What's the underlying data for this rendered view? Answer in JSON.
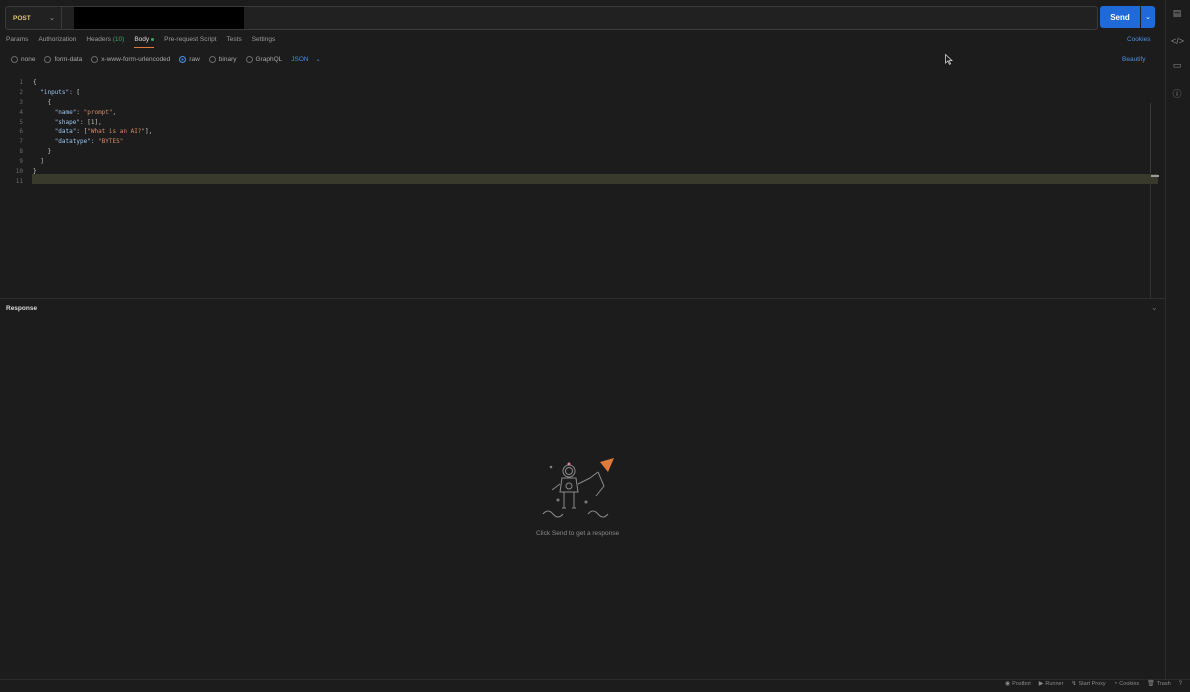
{
  "request": {
    "method": "POST",
    "send_label": "Send"
  },
  "tabs": [
    {
      "label": "Params"
    },
    {
      "label": "Authorization"
    },
    {
      "label": "Headers",
      "count": "(10)"
    },
    {
      "label": "Body"
    },
    {
      "label": "Pre-request Script"
    },
    {
      "label": "Tests"
    },
    {
      "label": "Settings"
    }
  ],
  "cookies_link": "Cookies",
  "body_types": [
    "none",
    "form-data",
    "x-www-form-urlencoded",
    "raw",
    "binary",
    "GraphQL"
  ],
  "body_type_selected": "raw",
  "format": "JSON",
  "beautify_label": "Beautify",
  "editor": {
    "line_numbers": [
      "1",
      "2",
      "3",
      "4",
      "5",
      "6",
      "7",
      "8",
      "9",
      "10",
      "11"
    ],
    "lines": [
      "{",
      "  \"inputs\": [",
      "    {",
      "      \"name\": \"prompt\",",
      "      \"shape\": [1],",
      "      \"data\": [\"What is an AI?\"],",
      "      \"datatype\": \"BYTES\"",
      "    }",
      "  ]",
      "}",
      ""
    ]
  },
  "response": {
    "title": "Response",
    "empty_message": "Click Send to get a response"
  },
  "statusbar": [
    {
      "label": "Postbot",
      "icon": "postbot-icon"
    },
    {
      "label": "Runner",
      "icon": "runner-icon"
    },
    {
      "label": "Start Proxy",
      "icon": "proxy-icon"
    },
    {
      "label": "Cookies",
      "icon": "cookie-icon"
    },
    {
      "label": "Trash",
      "icon": "trash-icon"
    }
  ],
  "colors": {
    "background": "#1c1c1c",
    "accent_blue": "#1f6ad8",
    "method_yellow": "#e0c472",
    "tab_underline": "#e07a3c",
    "link_blue": "#4a90e2"
  }
}
